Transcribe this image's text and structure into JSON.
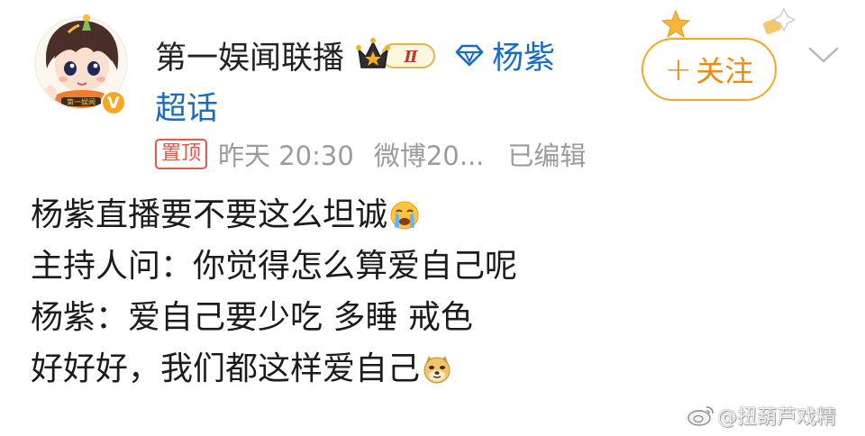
{
  "post": {
    "author": {
      "name": "第一娱闻联播",
      "vip_level": "Ⅱ",
      "avatar_caption": "第一娱闻",
      "verified_mark": "V"
    },
    "topic": {
      "name": "杨紫",
      "suffix": "超话"
    },
    "follow_button": {
      "plus": "+",
      "label": "关注"
    },
    "meta": {
      "pin_label": "置顶",
      "time": "昨天 20:30",
      "source": "微博20...",
      "edited": "已编辑"
    },
    "lines": [
      "杨紫直播要不要这么坦诚",
      "主持人问：你觉得怎么算爱自己呢",
      "杨紫：爱自己要少吃 多睡 戒色",
      "好好好，我们都这样爱自己"
    ],
    "emojis": {
      "line1": "crying-face-icon",
      "line4": "doge-icon"
    }
  },
  "watermark": {
    "text": "@扭葫芦戏精"
  },
  "colors": {
    "follow_orange": "#f5870a",
    "topic_blue": "#1a6bc4",
    "pin_red": "#e8544e",
    "meta_gray": "#9b9b9b"
  }
}
